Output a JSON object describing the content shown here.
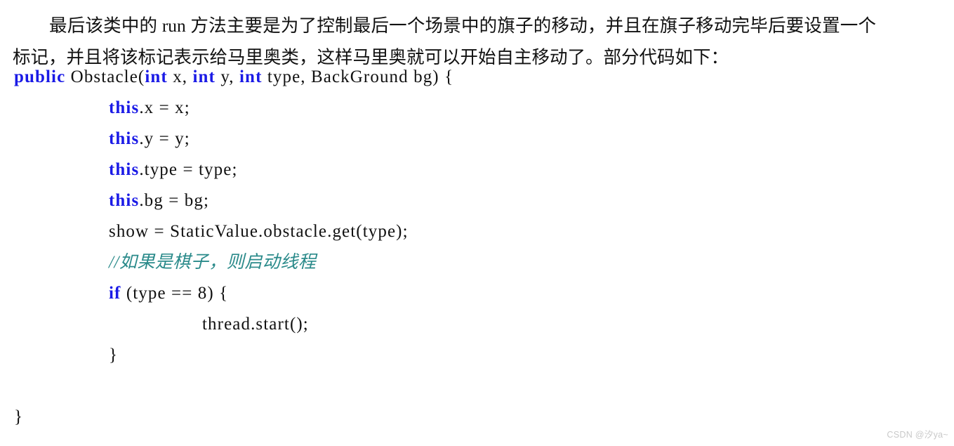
{
  "document": {
    "background_color": "#ffffff",
    "intro_paragraph": "最后该类中的 run 方法主要是为了控制最后一个场景中的旗子的移动，并且在旗子移动完毕后要设置一个标记，并且将该标记表示给马里奥类，这样马里奥就可以开始自主移动了。部分代码如下："
  },
  "colors": {
    "keyword": "#1a1ae6",
    "comment": "#2a8a8a",
    "plain": "#111111",
    "watermark": "#c9c9c9"
  },
  "code": {
    "language": "java",
    "lines": [
      {
        "indent": 0,
        "tokens": [
          {
            "kind": "keyword",
            "text": "public"
          },
          {
            "kind": "plain",
            "text": " Obstacle("
          },
          {
            "kind": "keyword",
            "text": "int"
          },
          {
            "kind": "plain",
            "text": " x, "
          },
          {
            "kind": "keyword",
            "text": "int"
          },
          {
            "kind": "plain",
            "text": " y, "
          },
          {
            "kind": "keyword",
            "text": "int"
          },
          {
            "kind": "plain",
            "text": " type, BackGround bg) {"
          }
        ]
      },
      {
        "indent": 1,
        "tokens": [
          {
            "kind": "keyword",
            "text": "this"
          },
          {
            "kind": "plain",
            "text": ".x = x;"
          }
        ]
      },
      {
        "indent": 1,
        "tokens": [
          {
            "kind": "keyword",
            "text": "this"
          },
          {
            "kind": "plain",
            "text": ".y = y;"
          }
        ]
      },
      {
        "indent": 1,
        "tokens": [
          {
            "kind": "keyword",
            "text": "this"
          },
          {
            "kind": "plain",
            "text": ".type = type;"
          }
        ]
      },
      {
        "indent": 1,
        "tokens": [
          {
            "kind": "keyword",
            "text": "this"
          },
          {
            "kind": "plain",
            "text": ".bg = bg;"
          }
        ]
      },
      {
        "indent": 1,
        "tokens": [
          {
            "kind": "plain",
            "text": "show = StaticValue.obstacle.get(type);"
          }
        ]
      },
      {
        "indent": 1,
        "tokens": [
          {
            "kind": "comment",
            "text": "//如果是棋子，则启动线程"
          }
        ]
      },
      {
        "indent": 1,
        "tokens": [
          {
            "kind": "keyword",
            "text": "if"
          },
          {
            "kind": "plain",
            "text": " (type == 8) {"
          }
        ]
      },
      {
        "indent": 2,
        "tokens": [
          {
            "kind": "plain",
            "text": "thread.start();"
          }
        ]
      },
      {
        "indent": 1,
        "tokens": [
          {
            "kind": "plain",
            "text": "}"
          }
        ]
      },
      {
        "indent": -1,
        "tokens": []
      },
      {
        "indent": 0,
        "tokens": [
          {
            "kind": "plain",
            "text": "}"
          }
        ]
      }
    ]
  },
  "watermark": {
    "text": "CSDN @汐ya~"
  }
}
